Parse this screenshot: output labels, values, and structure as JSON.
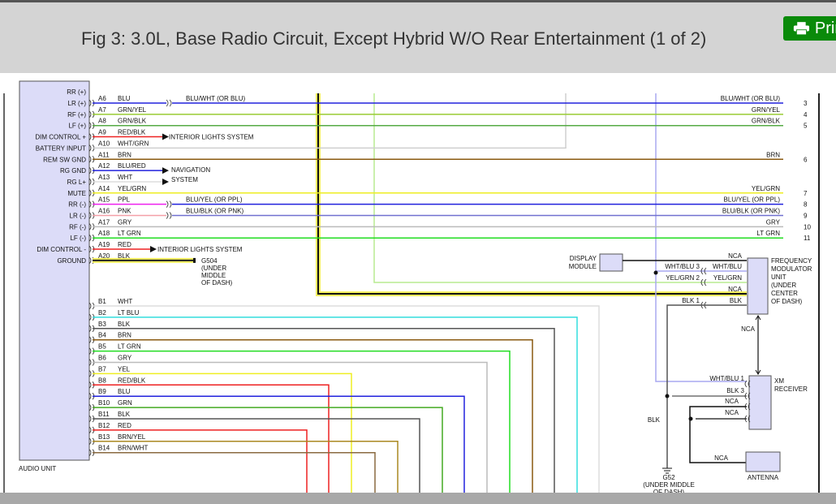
{
  "header": {
    "title": "Fig 3: 3.0L, Base Radio Circuit, Except Hybrid W/O Rear Entertainment (1 of 2)",
    "print_label": "Print"
  },
  "audio_unit": {
    "label": "AUDIO UNIT",
    "top_partial_label": "RR (+)",
    "a_pins": [
      {
        "pin": "A6",
        "wire": "BLU",
        "func": "LR (+)",
        "color": "#2222dd"
      },
      {
        "pin": "A7",
        "wire": "GRN/YEL",
        "func": "RF (+)",
        "color": "#99cc33"
      },
      {
        "pin": "A8",
        "wire": "GRN/BLK",
        "func": "LF (+)",
        "color": "#55aa44"
      },
      {
        "pin": "A9",
        "wire": "RED/BLK",
        "func": "DIM CONTROL +",
        "color": "#ee2222"
      },
      {
        "pin": "A10",
        "wire": "WHT/GRN",
        "func": "BATTERY INPUT",
        "color": "#cfcfcf"
      },
      {
        "pin": "A11",
        "wire": "BRN",
        "func": "REM SW GND",
        "color": "#8a5a10"
      },
      {
        "pin": "A12",
        "wire": "BLU/RED",
        "func": "RG GND",
        "color": "#2222dd"
      },
      {
        "pin": "A13",
        "wire": "WHT",
        "func": "RG L+",
        "color": "#dddddd"
      },
      {
        "pin": "A14",
        "wire": "YEL/GRN",
        "func": "MUTE",
        "color": "#eeee22"
      },
      {
        "pin": "A15",
        "wire": "PPL",
        "func": "RR (-)",
        "color": "#ee22ee"
      },
      {
        "pin": "A16",
        "wire": "PNK",
        "func": "LR (-)",
        "color": "#f4a0a8"
      },
      {
        "pin": "A17",
        "wire": "GRY",
        "func": "RF (-)",
        "color": "#bbbbbb"
      },
      {
        "pin": "A18",
        "wire": "LT GRN",
        "func": "LF (-)",
        "color": "#22dd22"
      },
      {
        "pin": "A19",
        "wire": "RED",
        "func": "DIM CONTROL -",
        "color": "#ee2222"
      },
      {
        "pin": "A20",
        "wire": "BLK",
        "func": "GROUND",
        "color": "#222222"
      }
    ],
    "b_pins": [
      {
        "pin": "B1",
        "wire": "WHT",
        "color": "#dddddd"
      },
      {
        "pin": "B2",
        "wire": "LT BLU",
        "color": "#33dddd"
      },
      {
        "pin": "B3",
        "wire": "BLK",
        "color": "#555555"
      },
      {
        "pin": "B4",
        "wire": "BRN",
        "color": "#8a5a10"
      },
      {
        "pin": "B5",
        "wire": "LT GRN",
        "color": "#22dd22"
      },
      {
        "pin": "B6",
        "wire": "GRY",
        "color": "#bbbbbb"
      },
      {
        "pin": "B7",
        "wire": "YEL",
        "color": "#eeee22"
      },
      {
        "pin": "B8",
        "wire": "RED/BLK",
        "color": "#ee2222"
      },
      {
        "pin": "B9",
        "wire": "BLU",
        "color": "#2222dd"
      },
      {
        "pin": "B10",
        "wire": "GRN",
        "color": "#44aa22"
      },
      {
        "pin": "B11",
        "wire": "BLK",
        "color": "#555555"
      },
      {
        "pin": "B12",
        "wire": "RED",
        "color": "#ee2222"
      },
      {
        "pin": "B13",
        "wire": "BRN/YEL",
        "color": "#aa8822"
      },
      {
        "pin": "B14",
        "wire": "BRN/WHT",
        "color": "#8a6a40"
      }
    ]
  },
  "destinations": {
    "interior_lights": "INTERIOR LIGHTS SYSTEM",
    "navigation": [
      "NAVIGATION",
      "SYSTEM"
    ],
    "g504": [
      "G504",
      "(UNDER",
      "MIDDLE",
      "OF DASH)"
    ]
  },
  "splices": {
    "a6": "BLU/WHT (OR BLU)",
    "a15": "BLU/YEL (OR PPL)",
    "a16": "BLU/BLK (OR PNK)"
  },
  "right_wires": [
    {
      "label": "BLU/WHT (OR BLU)",
      "num": "3"
    },
    {
      "label": "GRN/YEL",
      "num": "4"
    },
    {
      "label": "GRN/BLK",
      "num": "5"
    },
    {
      "label": "BRN",
      "num": "6"
    },
    {
      "label": "YEL/GRN",
      "num": "7"
    },
    {
      "label": "BLU/YEL (OR PPL)",
      "num": "8"
    },
    {
      "label": "BLU/BLK (OR PNK)",
      "num": "9"
    },
    {
      "label": "GRY",
      "num": "10"
    },
    {
      "label": "LT GRN",
      "num": "11"
    }
  ],
  "components": {
    "display_module": [
      "DISPLAY",
      "MODULE"
    ],
    "fm_unit": [
      "FREQUENCY",
      "MODULATOR",
      "UNIT",
      "(UNDER",
      "CENTER",
      "OF DASH)"
    ],
    "xm_receiver": [
      "XM",
      "RECEIVER"
    ],
    "antenna": "ANTENNA",
    "g52": [
      "G52",
      "(UNDER MIDDLE",
      "OF DASH)"
    ]
  },
  "fm_labels": {
    "nca": "NCA",
    "wht_blu": "WHT/BLU",
    "wht_blu_3": "WHT/BLU 3",
    "yel_grn": "YEL/GRN",
    "yel_grn_2": "YEL/GRN 2",
    "blk": "BLK",
    "blk_1": "BLK 1"
  },
  "xm_labels": {
    "wht_blu_1": "WHT/BLU 1",
    "blk_3": "BLK 3",
    "nca": "NCA",
    "blk": "BLK"
  }
}
